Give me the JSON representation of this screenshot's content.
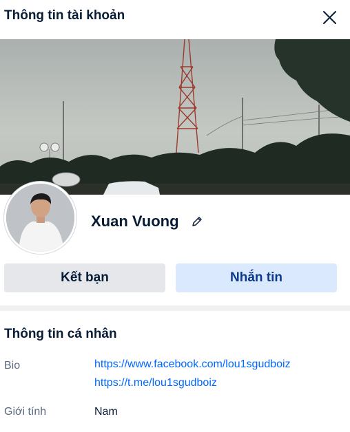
{
  "header": {
    "title": "Thông tin tài khoản",
    "close_icon": "close-icon"
  },
  "profile": {
    "name": "Xuan Vuong",
    "edit_icon": "pencil-icon",
    "cover_image": "cover-photo",
    "avatar_image": "avatar-photo"
  },
  "actions": {
    "add_friend_label": "Kết bạn",
    "message_label": "Nhắn tin"
  },
  "personal_info": {
    "section_title": "Thông tin cá nhân",
    "bio_label": "Bio",
    "bio_links": [
      "https://www.facebook.com/lou1sgudboiz",
      "https://t.me/lou1sgudboiz"
    ],
    "gender_label": "Giới tính",
    "gender_value": "Nam"
  },
  "colors": {
    "link": "#0068ff",
    "message_button_bg": "#dbe9ff",
    "friend_button_bg": "#e5e7eb",
    "text": "#081c36",
    "label": "#5a6981"
  }
}
